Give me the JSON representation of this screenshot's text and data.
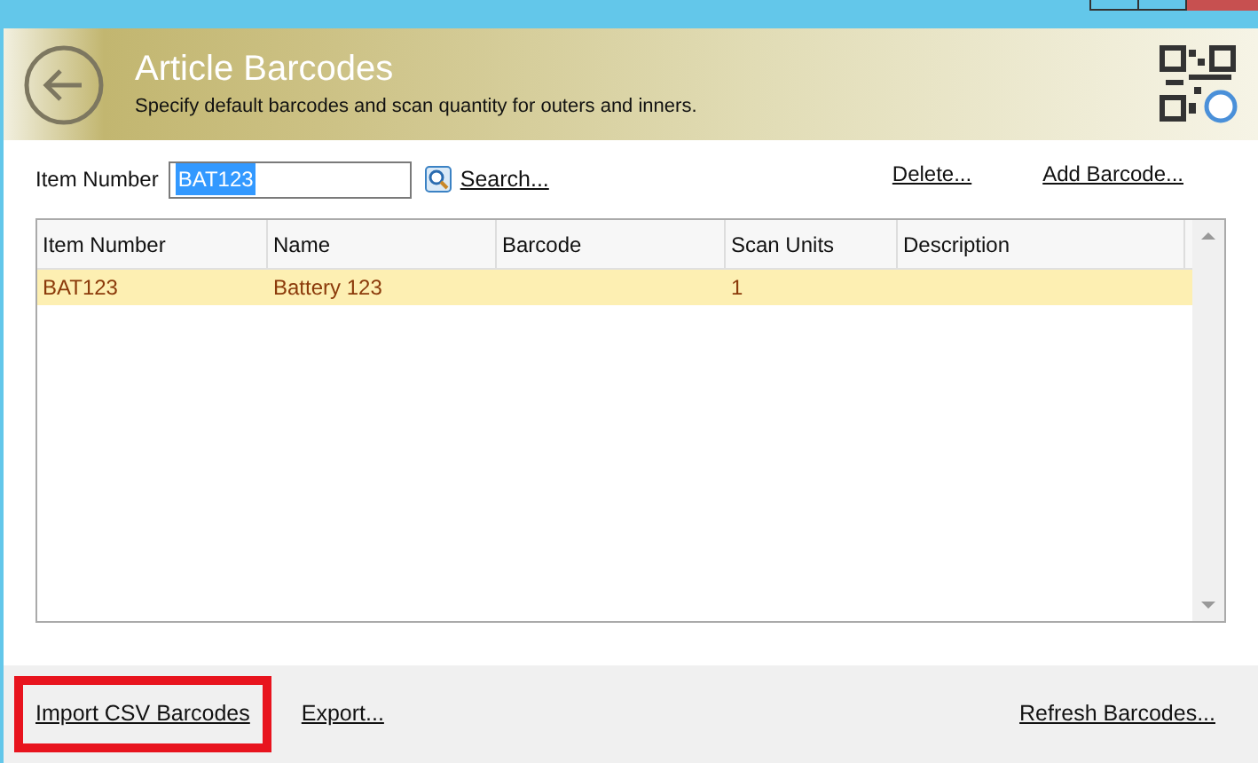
{
  "header": {
    "title": "Article Barcodes",
    "subtitle": "Specify default barcodes and scan quantity for outers and inners."
  },
  "search": {
    "label": "Item Number",
    "value": "BAT123",
    "value_selected": true,
    "search_link": "Search..."
  },
  "actions": [
    "Delete...",
    "Add Barcode..."
  ],
  "table": {
    "columns": [
      "Item Number",
      "Name",
      "Barcode",
      "Scan Units",
      "Description"
    ],
    "rows": [
      {
        "selected": true,
        "cells": [
          "BAT123",
          "Battery 123",
          "",
          "1",
          ""
        ]
      }
    ]
  },
  "footer": {
    "left": [
      {
        "label": "Import CSV Barcodes",
        "highlighted": true
      },
      {
        "label": "Export...",
        "highlighted": false
      }
    ],
    "right": "Refresh Barcodes..."
  }
}
